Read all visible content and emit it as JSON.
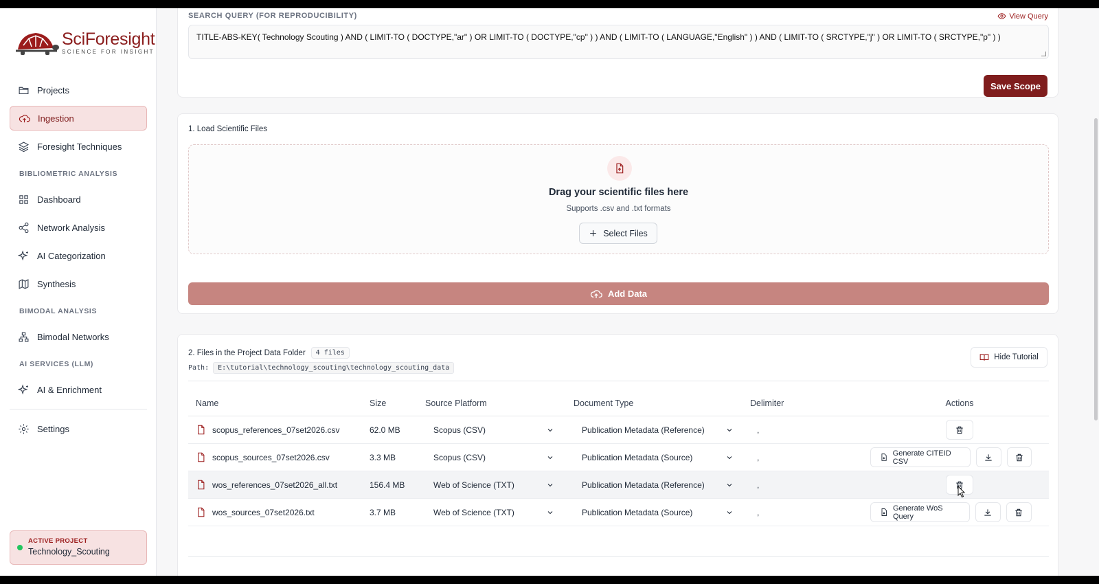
{
  "app": {
    "brand": "SciForesight",
    "tagline": "SCIENCE FOR INSIGHT"
  },
  "sidebar": {
    "items_top": [
      {
        "label": "Projects",
        "icon": "folder-icon"
      },
      {
        "label": "Ingestion",
        "icon": "cloud-upload-icon",
        "active": true
      },
      {
        "label": "Foresight Techniques",
        "icon": "layers-icon"
      }
    ],
    "section_bibliometric": "BIBLIOMETRIC ANALYSIS",
    "items_bibliometric": [
      {
        "label": "Dashboard",
        "icon": "grid-icon"
      },
      {
        "label": "Network Analysis",
        "icon": "share-icon"
      },
      {
        "label": "AI Categorization",
        "icon": "sparkles-icon"
      },
      {
        "label": "Synthesis",
        "icon": "map-icon"
      }
    ],
    "section_bimodal": "BIMODAL ANALYSIS",
    "items_bimodal": [
      {
        "label": "Bimodal Networks",
        "icon": "network-icon"
      }
    ],
    "section_ai": "AI SERVICES (LLM)",
    "items_ai": [
      {
        "label": "AI & Enrichment",
        "icon": "sparkles-icon"
      }
    ],
    "settings": {
      "label": "Settings",
      "icon": "gear-icon"
    },
    "active_project": {
      "label": "ACTIVE PROJECT",
      "name": "Technology_Scouting"
    }
  },
  "scope": {
    "title": "SEARCH QUERY (FOR REPRODUCIBILITY)",
    "view_query": "View Query",
    "query": "TITLE-ABS-KEY( Technology Scouting ) AND ( LIMIT-TO ( DOCTYPE,\"ar\" ) OR LIMIT-TO ( DOCTYPE,\"cp\" ) ) AND ( LIMIT-TO ( LANGUAGE,\"English\" ) ) AND ( LIMIT-TO ( SRCTYPE,\"j\" ) OR LIMIT-TO ( SRCTYPE,\"p\" ) )",
    "save_label": "Save Scope"
  },
  "load": {
    "title": "1. Load Scientific Files",
    "drop_title": "Drag your scientific files here",
    "drop_sub": "Supports .csv and .txt formats",
    "select_label": "Select Files",
    "add_label": "Add Data"
  },
  "files": {
    "title": "2. Files in the Project Data Folder",
    "count_badge": "4 files",
    "path_label": "Path:",
    "path": "E:\\tutorial\\technology_scouting\\technology_scouting_data",
    "hide_tutorial": "Hide Tutorial",
    "columns": {
      "name": "Name",
      "size": "Size",
      "platform": "Source Platform",
      "doctype": "Document Type",
      "delimiter": "Delimiter",
      "actions": "Actions"
    },
    "rows": [
      {
        "name": "scopus_references_07set2026.csv",
        "size": "62.0 MB",
        "platform": "Scopus (CSV)",
        "doctype": "Publication Metadata (Reference)",
        "delimiter": ",",
        "gen": ""
      },
      {
        "name": "scopus_sources_07set2026.csv",
        "size": "3.3 MB",
        "platform": "Scopus (CSV)",
        "doctype": "Publication Metadata (Source)",
        "delimiter": ",",
        "gen": "Generate CITEID CSV"
      },
      {
        "name": "wos_references_07set2026_all.txt",
        "size": "156.4 MB",
        "platform": "Web of Science (TXT)",
        "doctype": "Publication Metadata (Reference)",
        "delimiter": ",",
        "gen": ""
      },
      {
        "name": "wos_sources_07set2026.txt",
        "size": "3.7 MB",
        "platform": "Web of Science (TXT)",
        "doctype": "Publication Metadata (Source)",
        "delimiter": ",",
        "gen": "Generate WoS Query"
      }
    ]
  },
  "colors": {
    "accent": "#7f1d1d",
    "accent_soft": "#f7e2e2",
    "add_data": "#c68580",
    "status_dot": "#22c55e"
  }
}
